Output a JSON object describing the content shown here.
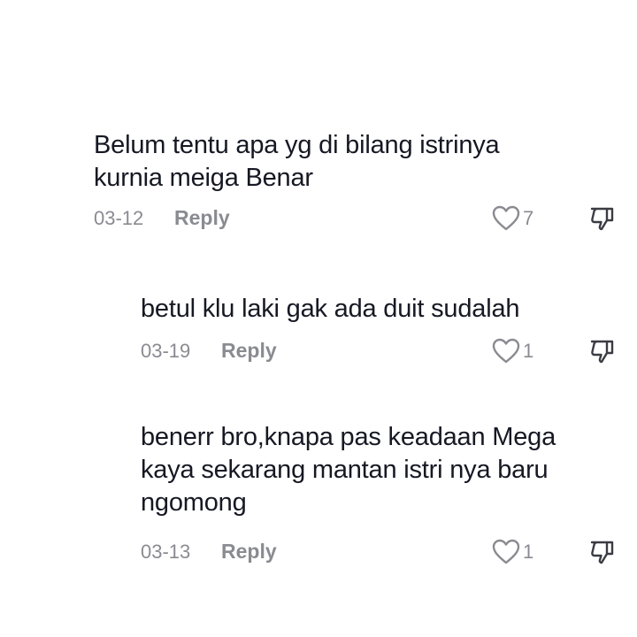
{
  "comments": [
    {
      "text": "Belum tentu apa yg di bilang istrinya\nkurnia meiga Benar",
      "date": "03-12",
      "reply_label": "Reply",
      "likes": "7"
    },
    {
      "text": "betul klu laki gak ada duit sudalah",
      "date": "03-19",
      "reply_label": "Reply",
      "likes": "1"
    },
    {
      "text": "benerr bro,knapa pas keadaan Mega\nkaya sekarang mantan istri nya baru\nngomong",
      "date": "03-13",
      "reply_label": "Reply",
      "likes": "1"
    }
  ],
  "icons": {
    "like": "heart-outline-icon",
    "dislike": "thumbs-down-outline-icon"
  },
  "colors": {
    "text": "#161823",
    "meta": "#8a8b91",
    "background": "#ffffff"
  }
}
